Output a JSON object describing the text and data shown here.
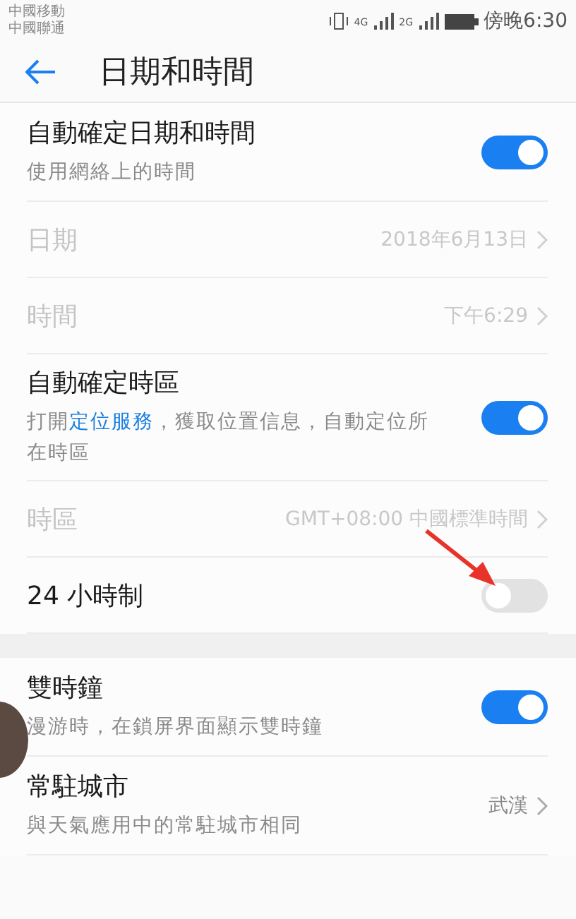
{
  "status_bar": {
    "carriers": [
      "中國移動",
      "中國聯通"
    ],
    "network_labels": [
      "4G",
      "2G"
    ],
    "time": "傍晚6:30"
  },
  "header": {
    "title": "日期和時間"
  },
  "sections": [
    {
      "items": [
        {
          "kind": "toggle",
          "title": "自動確定日期和時間",
          "description": [
            {
              "text": "使用網絡上的時間",
              "link": false
            }
          ],
          "on": true,
          "disabled": false
        },
        {
          "kind": "value",
          "title": "日期",
          "value": "2018年6月13日",
          "disabled": true
        },
        {
          "kind": "value",
          "title": "時間",
          "value": "下午6:29",
          "disabled": true
        },
        {
          "kind": "toggle",
          "title": "自動確定時區",
          "description": [
            {
              "text": "打開",
              "link": false
            },
            {
              "text": "定位服務",
              "link": true
            },
            {
              "text": "，獲取位置信息，自動定位所在時區",
              "link": false
            }
          ],
          "on": true,
          "disabled": false
        },
        {
          "kind": "value",
          "title": "時區",
          "value": "GMT+08:00 中國標準時間",
          "disabled": true
        },
        {
          "kind": "toggle",
          "title": "24 小時制",
          "on": false,
          "disabled": false
        }
      ]
    },
    {
      "items": [
        {
          "kind": "toggle",
          "title": "雙時鐘",
          "description": [
            {
              "text": "漫游時，在鎖屏界面顯示雙時鐘",
              "link": false
            }
          ],
          "on": true,
          "disabled": false
        },
        {
          "kind": "value",
          "title": "常駐城市",
          "description": [
            {
              "text": "與天氣應用中的常駐城市相同",
              "link": false
            }
          ],
          "value": "武漢",
          "disabled": false
        }
      ]
    }
  ]
}
